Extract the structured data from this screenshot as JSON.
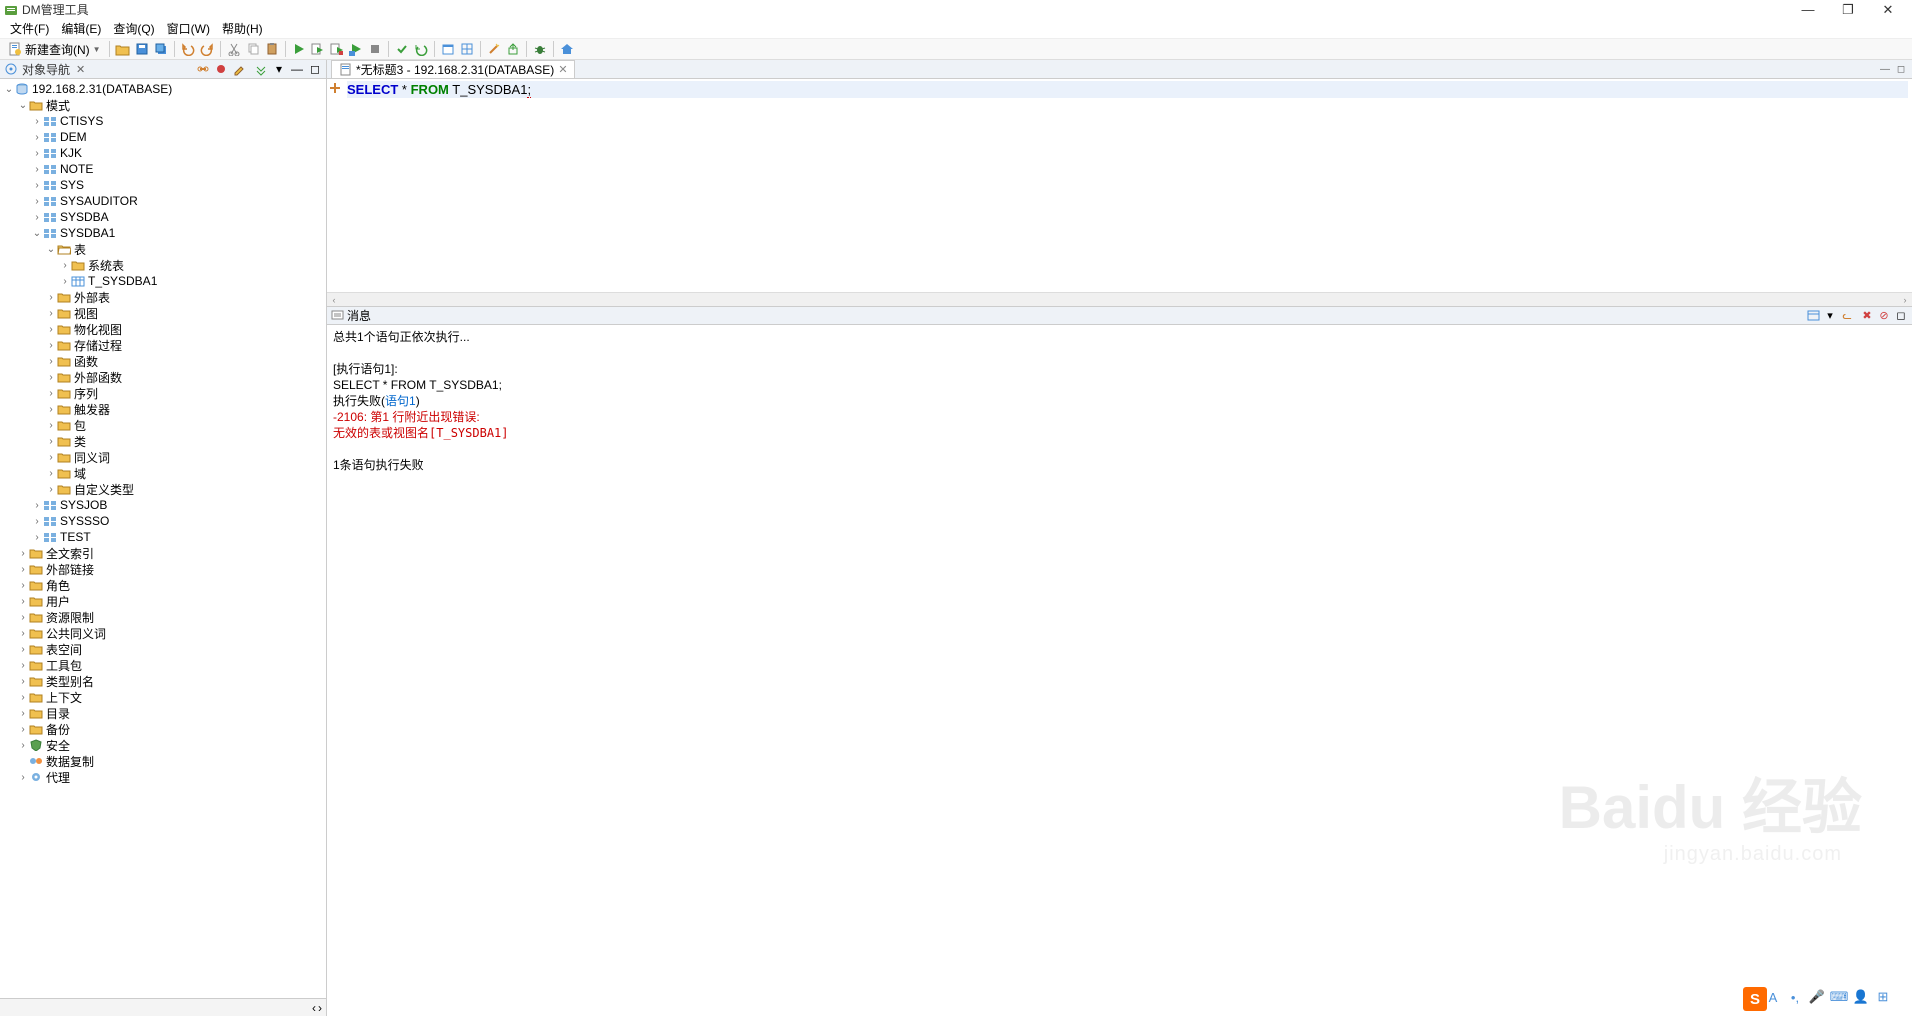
{
  "app": {
    "title": "DM管理工具"
  },
  "menu": {
    "file": "文件(F)",
    "edit": "编辑(E)",
    "query": "查询(Q)",
    "window": "窗口(W)",
    "help": "帮助(H)"
  },
  "toolbar": {
    "new_query": "新建查询(N)"
  },
  "left_panel": {
    "title": "对象导航",
    "root": "192.168.2.31(DATABASE)",
    "schema_folder": "模式",
    "schemas": {
      "ctisys": "CTISYS",
      "dem": "DEM",
      "kjk": "KJK",
      "note": "NOTE",
      "sys": "SYS",
      "sysauditor": "SYSAUDITOR",
      "sysdba": "SYSDBA",
      "sysdba1": "SYSDBA1",
      "sysjob": "SYSJOB",
      "syssso": "SYSSSO",
      "test": "TEST"
    },
    "sysdba1_children": {
      "tables": "表",
      "system_tables": "系统表",
      "t_sysdba1": "T_SYSDBA1",
      "external_tables": "外部表",
      "views": "视图",
      "materialized_views": "物化视图",
      "stored_procedures": "存储过程",
      "functions": "函数",
      "external_functions": "外部函数",
      "sequences": "序列",
      "triggers": "触发器",
      "packages": "包",
      "classes": "类",
      "synonyms": "同义词",
      "domains": "域",
      "custom_types": "自定义类型"
    },
    "top_folders": {
      "fulltext_index": "全文索引",
      "external_links": "外部链接",
      "roles": "角色",
      "users": "用户",
      "resource_limits": "资源限制",
      "public_synonyms": "公共同义词",
      "tablespaces": "表空间",
      "tool_packages": "工具包",
      "type_aliases": "类型别名",
      "context": "上下文",
      "directories": "目录",
      "backup": "备份",
      "security": "安全",
      "data_replication": "数据复制",
      "agent": "代理"
    }
  },
  "editor": {
    "tab_title": "*无标题3 - 192.168.2.31(DATABASE)",
    "sql": {
      "select": "SELECT",
      "star": "*",
      "from": "FROM",
      "table": "T_SYSDBA1"
    }
  },
  "message_panel": {
    "title": "消息",
    "line1": "总共1个语句正依次执行...",
    "line2": "[执行语句1]:",
    "line3": "SELECT * FROM T_SYSDBA1;",
    "line4_prefix": "执行失败(",
    "line4_link": "语句1",
    "line4_suffix": ")",
    "line5": "-2106: 第1 行附近出现错误:",
    "line6_prefix": "无效的表或视图名",
    "line6_mono": "[T_SYSDBA1]",
    "line7": "1条语句执行失败"
  },
  "watermark": {
    "main": "Baidu 经验",
    "sub": "jingyan.baidu.com"
  },
  "float_badge": "S"
}
